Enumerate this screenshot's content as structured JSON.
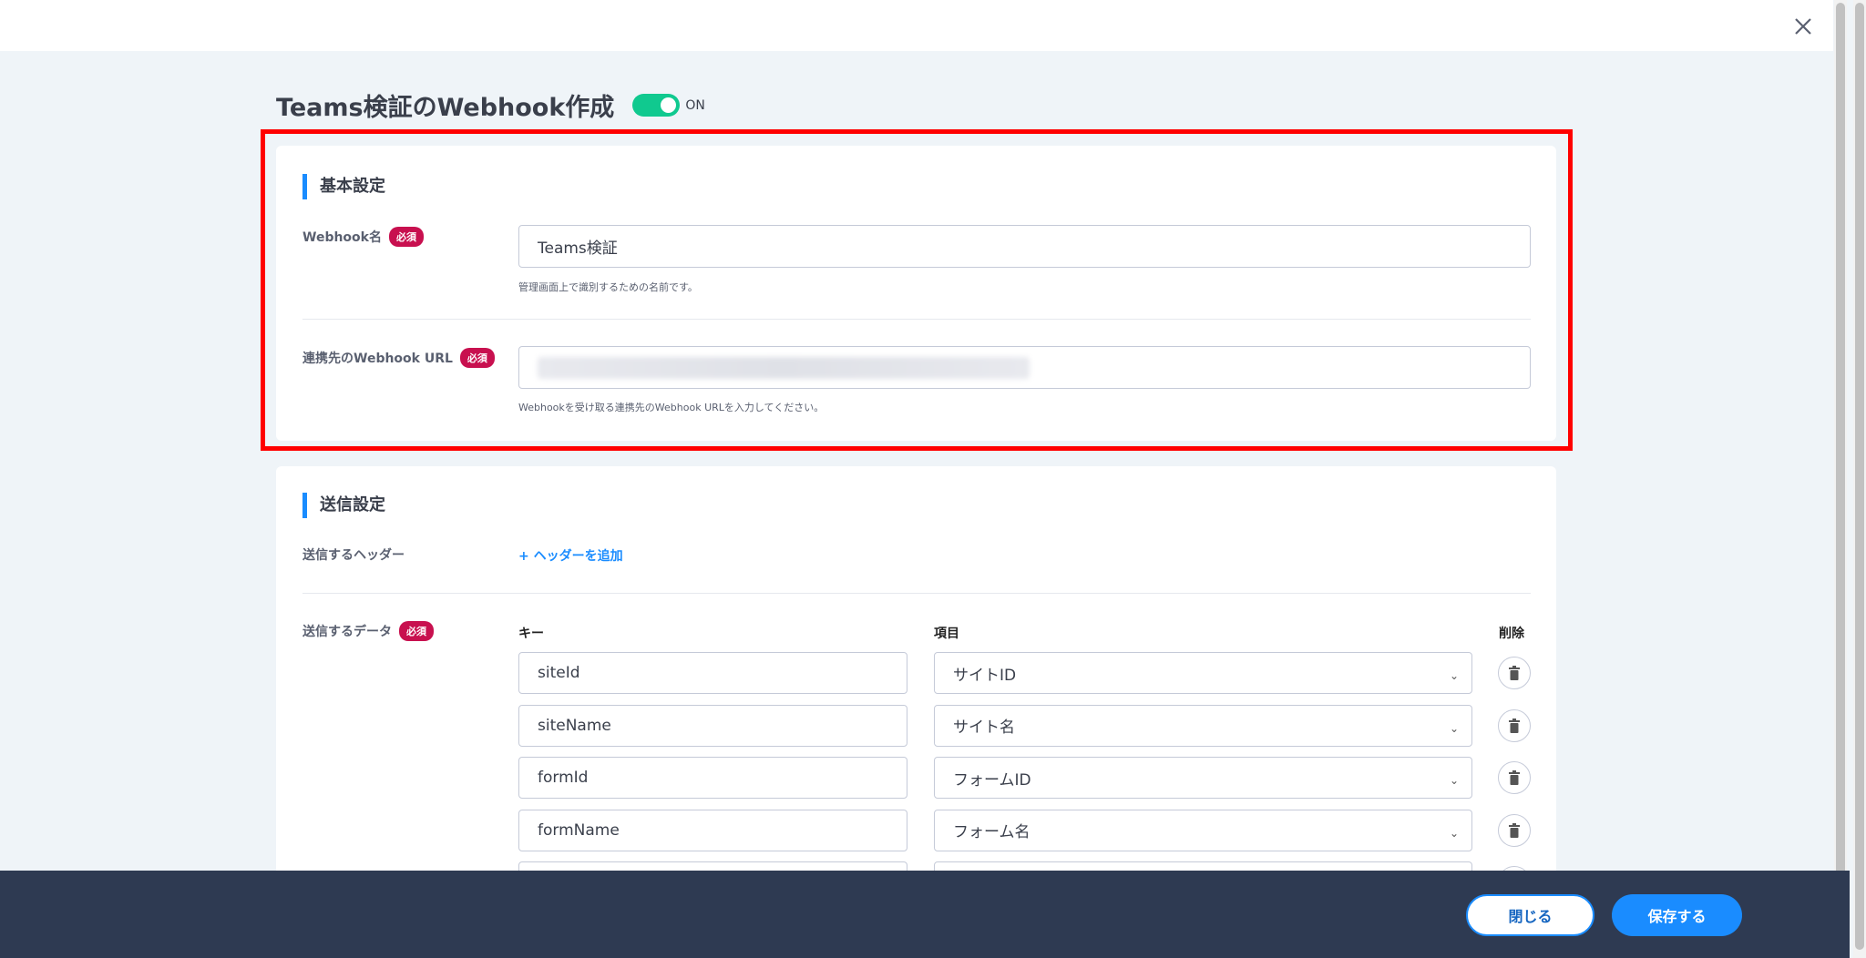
{
  "title": "Teams検証のWebhook作成",
  "toggle": {
    "label": "ON",
    "on": true
  },
  "basic": {
    "heading": "基本設定",
    "required": "必須",
    "name_label": "Webhook名",
    "name_value": "Teams検証",
    "name_help": "管理画面上で識別するための名前です。",
    "url_label": "連携先のWebhook URL",
    "url_help": "Webhookを受け取る連携先のWebhook URLを入力してください。"
  },
  "send": {
    "heading": "送信設定",
    "header_label": "送信するヘッダー",
    "add_header": "+ ヘッダーを追加",
    "data_label": "送信するデータ",
    "required": "必須",
    "col_key": "キー",
    "col_item": "項目",
    "col_delete": "削除",
    "rows": [
      {
        "key": "siteId",
        "item": "サイトID"
      },
      {
        "key": "siteName",
        "item": "サイト名"
      },
      {
        "key": "formId",
        "item": "フォームID"
      },
      {
        "key": "formName",
        "item": "フォーム名"
      },
      {
        "key": "",
        "item": ""
      }
    ]
  },
  "footer": {
    "close": "閉じる",
    "save": "保存する"
  }
}
